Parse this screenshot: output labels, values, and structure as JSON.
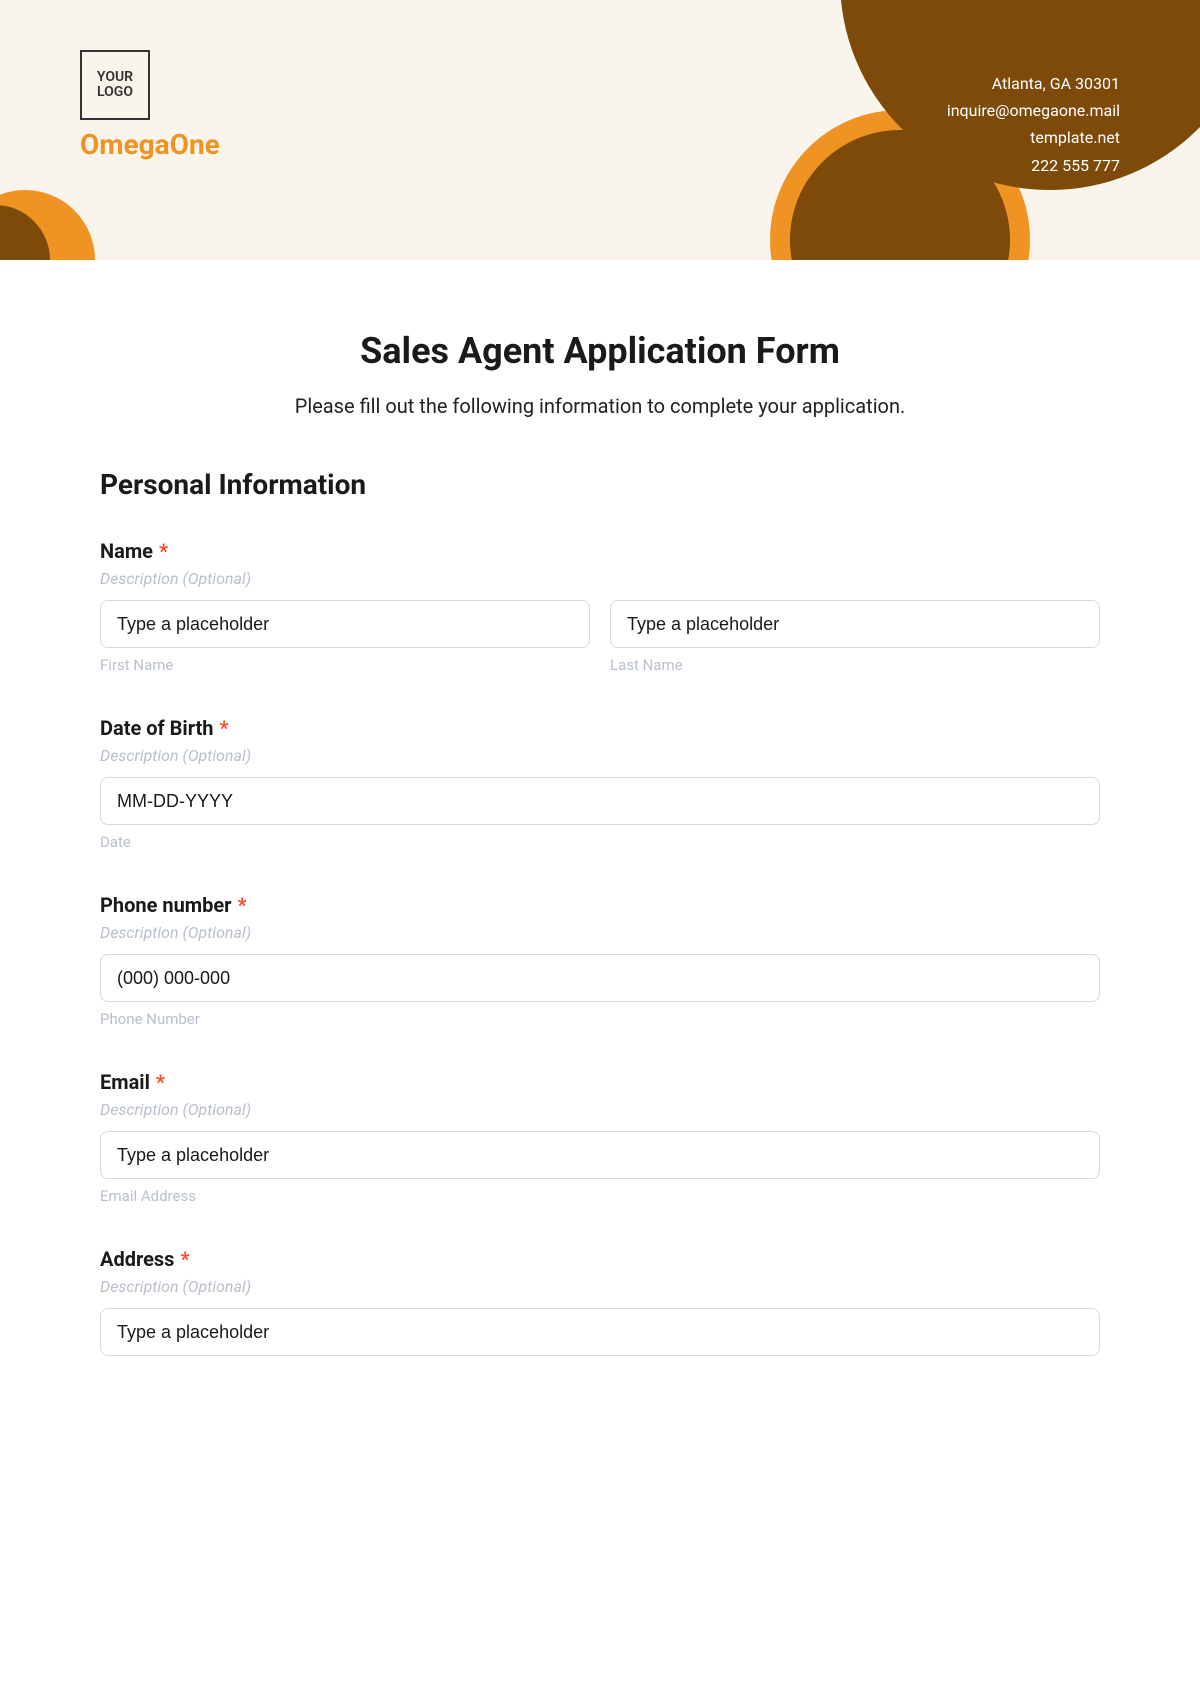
{
  "header": {
    "logo_text": "YOUR LOGO",
    "company_name": "OmegaOne",
    "address_line1": "Atlanta, GA 30301",
    "email": "inquire@omegaone.mail",
    "website": "template.net",
    "phone": "222 555 777"
  },
  "form": {
    "title": "Sales Agent Application Form",
    "subtitle": "Please fill out the following information to complete your application.",
    "section_heading": "Personal Information",
    "name": {
      "label": "Name",
      "description": "Description (Optional)",
      "first_placeholder": "Type a placeholder",
      "first_sublabel": "First Name",
      "last_placeholder": "Type a placeholder",
      "last_sublabel": "Last Name"
    },
    "dob": {
      "label": "Date of Birth",
      "description": "Description (Optional)",
      "placeholder": "MM-DD-YYYY",
      "sublabel": "Date"
    },
    "phone": {
      "label": "Phone number",
      "description": "Description (Optional)",
      "placeholder": "(000) 000-000",
      "sublabel": "Phone Number"
    },
    "email": {
      "label": "Email",
      "description": "Description (Optional)",
      "placeholder": "Type a placeholder",
      "sublabel": "Email Address"
    },
    "address": {
      "label": "Address",
      "description": "Description (Optional)",
      "placeholder": "Type a placeholder"
    },
    "required_marker": "*"
  }
}
